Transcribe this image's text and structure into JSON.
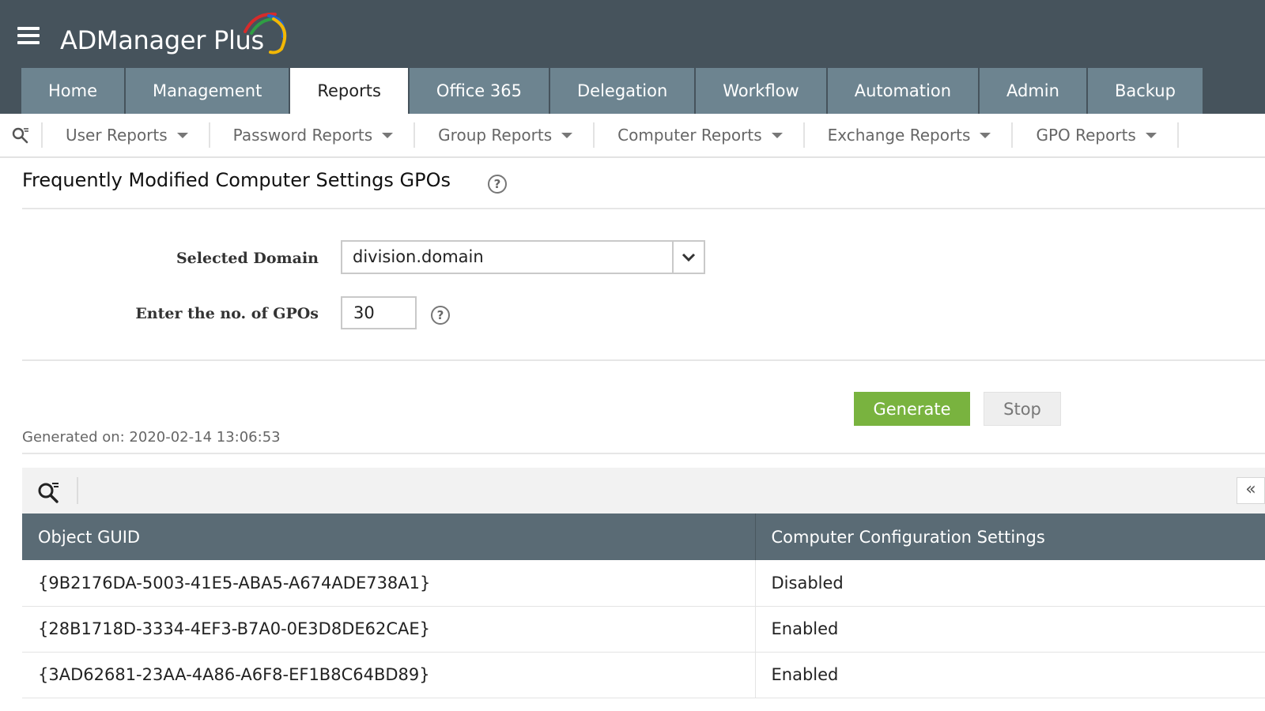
{
  "app": {
    "logo_text": "ADManager Plus"
  },
  "main_tabs": [
    {
      "label": "Home"
    },
    {
      "label": "Management"
    },
    {
      "label": "Reports"
    },
    {
      "label": "Office 365"
    },
    {
      "label": "Delegation"
    },
    {
      "label": "Workflow"
    },
    {
      "label": "Automation"
    },
    {
      "label": "Admin"
    },
    {
      "label": "Backup"
    }
  ],
  "active_tab": "Reports",
  "sub_nav": [
    {
      "label": "User Reports"
    },
    {
      "label": "Password Reports"
    },
    {
      "label": "Group Reports"
    },
    {
      "label": "Computer Reports"
    },
    {
      "label": "Exchange Reports"
    },
    {
      "label": "GPO Reports"
    }
  ],
  "page": {
    "title": "Frequently Modified Computer Settings GPOs"
  },
  "form": {
    "domain_label": "Selected Domain",
    "domain_value": "division.domain",
    "count_label": "Enter the no. of GPOs",
    "count_value": "30"
  },
  "actions": {
    "generate_label": "Generate",
    "stop_label": "Stop"
  },
  "report": {
    "generated_on": "Generated on: 2020-02-14 13:06:53",
    "collapse_glyph": "«",
    "columns": [
      "Object GUID",
      "Computer Configuration Settings"
    ],
    "rows": [
      [
        "{9B2176DA-5003-41E5-ABA5-A674ADE738A1}",
        "Disabled"
      ],
      [
        "{28B1718D-3334-4EF3-B7A0-0E3D8DE62CAE}",
        "Enabled"
      ],
      [
        "{3AD62681-23AA-4A86-A6F8-EF1B8C64BD89}",
        "Enabled"
      ]
    ]
  },
  "icons": {
    "menu": "hamburger-icon",
    "search": "search-filter-icon",
    "help": "help-circle-icon",
    "dropdown": "chevron-down-icon",
    "collapse": "double-chevron-left-icon"
  },
  "colors": {
    "header_bg": "#46535c",
    "tab_bg": "#6d8490",
    "generate_btn": "#79b33f",
    "table_header_bg": "#5a6b75"
  }
}
